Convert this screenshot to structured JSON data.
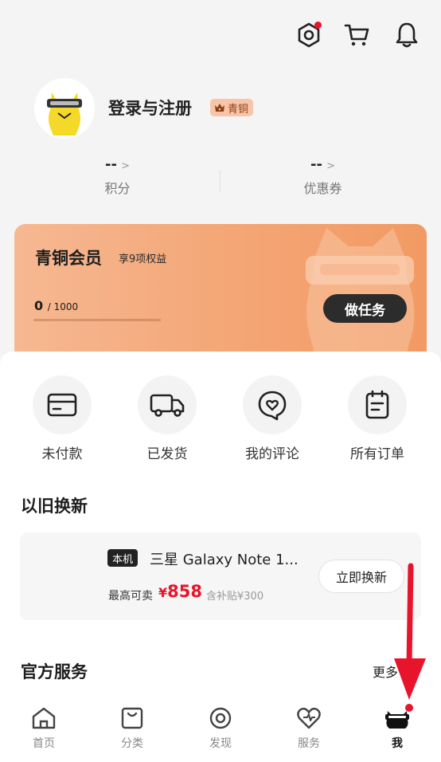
{
  "header": {
    "icons": [
      "settings-icon",
      "cart-icon",
      "bell-icon"
    ],
    "settings_has_notification": true
  },
  "profile": {
    "name": "登录与注册",
    "level_badge": "青铜",
    "stats": [
      {
        "value": "--",
        "label": "积分"
      },
      {
        "value": "--",
        "label": "优惠券"
      }
    ]
  },
  "membership": {
    "title": "青铜会员",
    "subtitle": "享9项权益",
    "progress_current": "0",
    "progress_total": "/ 1000",
    "progress_fraction": 0,
    "task_button": "做任务"
  },
  "orders": [
    {
      "label": "未付款",
      "icon": "card-icon"
    },
    {
      "label": "已发货",
      "icon": "truck-icon"
    },
    {
      "label": "我的评论",
      "icon": "comment-heart-icon"
    },
    {
      "label": "所有订单",
      "icon": "order-list-icon"
    }
  ],
  "trade_in": {
    "section_title": "以旧换新",
    "tag": "本机",
    "phone_name": "三星 Galaxy Note 1...",
    "max_label": "最高可卖",
    "price_symbol": "¥",
    "price": "858",
    "subsidy": "含补贴¥300",
    "button": "立即换新"
  },
  "services": {
    "section_title": "官方服务",
    "more": "更多"
  },
  "tabbar": {
    "tabs": [
      {
        "label": "首页",
        "icon": "home-icon"
      },
      {
        "label": "分类",
        "icon": "category-bag-icon"
      },
      {
        "label": "发现",
        "icon": "discover-icon"
      },
      {
        "label": "服务",
        "icon": "service-heart-icon"
      },
      {
        "label": "我",
        "icon": "mascot-icon"
      }
    ],
    "active": "我"
  },
  "colors": {
    "accent_red": "#e8142b",
    "card_orange": "#f4a777",
    "badge_bg": "#f8c5a8"
  }
}
